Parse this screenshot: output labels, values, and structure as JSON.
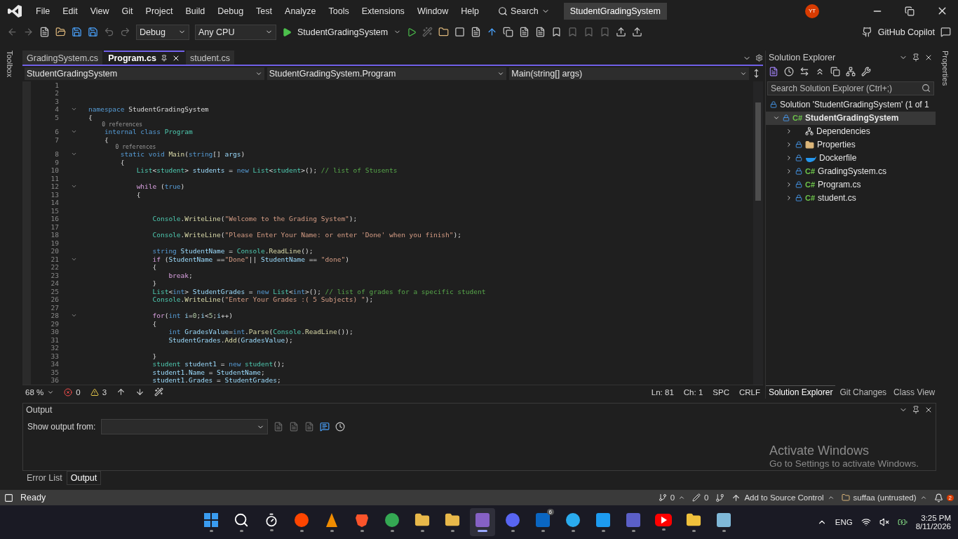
{
  "menu": [
    "File",
    "Edit",
    "View",
    "Git",
    "Project",
    "Build",
    "Debug",
    "Test",
    "Analyze",
    "Tools",
    "Extensions",
    "Window",
    "Help"
  ],
  "search": "Search",
  "solution_title": "StudentGradingSystem",
  "avatar": "YT",
  "toolbar": {
    "configuration": "Debug",
    "platform": "Any CPU",
    "startup": "StudentGradingSystem",
    "copilot": "GitHub Copilot"
  },
  "toolbox": "Toolbox",
  "properties_tab": "Properties",
  "tabs": [
    {
      "label": "GradingSystem.cs",
      "selected": false
    },
    {
      "label": "Program.cs",
      "selected": true
    },
    {
      "label": "student.cs",
      "selected": false
    }
  ],
  "nav": [
    "StudentGradingSystem",
    "StudentGradingSystem.Program",
    "Main(string[] args)"
  ],
  "code": [
    {
      "kind": "line",
      "n": "1",
      "fold": false
    },
    {
      "kind": "line",
      "n": "2",
      "fold": false
    },
    {
      "kind": "line",
      "n": "3",
      "fold": false
    },
    {
      "kind": "line",
      "n": "4",
      "fold": true,
      "tokens": [
        {
          "text": "namespace",
          "kind": "kw"
        },
        {
          "text": " StudentGradingSystem",
          "kind": "txt"
        }
      ]
    },
    {
      "kind": "line",
      "n": "5",
      "fold": false,
      "tokens": [
        {
          "text": "{",
          "kind": "txt"
        }
      ]
    },
    {
      "kind": "lens",
      "text": "    0 references"
    },
    {
      "kind": "line",
      "n": "6",
      "fold": true,
      "tokens": [
        {
          "text": "    internal class",
          "kind": "kw"
        },
        {
          "text": " Program",
          "kind": "type"
        }
      ]
    },
    {
      "kind": "line",
      "n": "7",
      "fold": false,
      "tokens": [
        {
          "text": "    {",
          "kind": "txt"
        }
      ]
    },
    {
      "kind": "lens",
      "text": "        0 references"
    },
    {
      "kind": "line",
      "n": "8",
      "fold": true,
      "tokens": [
        {
          "text": "        static void",
          "kind": "kw"
        },
        {
          "text": " Main",
          "kind": "fn"
        },
        {
          "text": "(",
          "kind": "txt"
        },
        {
          "text": "string",
          "kind": "kw"
        },
        {
          "text": "[] ",
          "kind": "txt"
        },
        {
          "text": "args",
          "kind": "var"
        },
        {
          "text": ")",
          "kind": "txt"
        }
      ]
    },
    {
      "kind": "line",
      "n": "9",
      "fold": false,
      "tokens": [
        {
          "text": "        {",
          "kind": "txt"
        }
      ]
    },
    {
      "kind": "line",
      "n": "10",
      "fold": false,
      "tokens": [
        {
          "text": "            List",
          "kind": "type"
        },
        {
          "text": "<",
          "kind": "txt"
        },
        {
          "text": "student",
          "kind": "type"
        },
        {
          "text": "> ",
          "kind": "txt"
        },
        {
          "text": "students",
          "kind": "var"
        },
        {
          "text": " = ",
          "kind": "txt"
        },
        {
          "text": "new",
          "kind": "kw"
        },
        {
          "text": " List",
          "kind": "type"
        },
        {
          "text": "<",
          "kind": "txt"
        },
        {
          "text": "student",
          "kind": "type"
        },
        {
          "text": ">(); ",
          "kind": "txt"
        },
        {
          "text": "// list of Stusents",
          "kind": "cmt"
        }
      ]
    },
    {
      "kind": "line",
      "n": "11",
      "fold": false
    },
    {
      "kind": "line",
      "n": "12",
      "fold": true,
      "tokens": [
        {
          "text": "            while",
          "kind": "ctl"
        },
        {
          "text": " (",
          "kind": "txt"
        },
        {
          "text": "true",
          "kind": "kw"
        },
        {
          "text": ")",
          "kind": "txt"
        }
      ]
    },
    {
      "kind": "line",
      "n": "13",
      "fold": false,
      "tokens": [
        {
          "text": "            {",
          "kind": "txt"
        }
      ]
    },
    {
      "kind": "line",
      "n": "14",
      "fold": false
    },
    {
      "kind": "line",
      "n": "15",
      "fold": false
    },
    {
      "kind": "line",
      "n": "16",
      "fold": false,
      "tokens": [
        {
          "text": "                Console",
          "kind": "type"
        },
        {
          "text": ".",
          "kind": "txt"
        },
        {
          "text": "WriteLine",
          "kind": "fn"
        },
        {
          "text": "(",
          "kind": "txt"
        },
        {
          "text": "\"Welcome to the Grading System\"",
          "kind": "str"
        },
        {
          "text": ");",
          "kind": "txt"
        }
      ]
    },
    {
      "kind": "line",
      "n": "17",
      "fold": false
    },
    {
      "kind": "line",
      "n": "18",
      "fold": false,
      "tokens": [
        {
          "text": "                Console",
          "kind": "type"
        },
        {
          "text": ".",
          "kind": "txt"
        },
        {
          "text": "WriteLine",
          "kind": "fn"
        },
        {
          "text": "(",
          "kind": "txt"
        },
        {
          "text": "\"Please Enter Your Name: or enter 'Done' when you finish\"",
          "kind": "str"
        },
        {
          "text": ");",
          "kind": "txt"
        }
      ]
    },
    {
      "kind": "line",
      "n": "19",
      "fold": false
    },
    {
      "kind": "line",
      "n": "20",
      "fold": false,
      "tokens": [
        {
          "text": "                string",
          "kind": "kw"
        },
        {
          "text": " StudentName",
          "kind": "var"
        },
        {
          "text": " = ",
          "kind": "txt"
        },
        {
          "text": "Console",
          "kind": "type"
        },
        {
          "text": ".",
          "kind": "txt"
        },
        {
          "text": "ReadLine",
          "kind": "fn"
        },
        {
          "text": "();",
          "kind": "txt"
        }
      ]
    },
    {
      "kind": "line",
      "n": "21",
      "fold": true,
      "tokens": [
        {
          "text": "                if",
          "kind": "ctl"
        },
        {
          "text": " (",
          "kind": "txt"
        },
        {
          "text": "StudentName",
          "kind": "var"
        },
        {
          "text": " ==",
          "kind": "txt"
        },
        {
          "text": "\"Done\"",
          "kind": "str"
        },
        {
          "text": "|| ",
          "kind": "txt"
        },
        {
          "text": "StudentName",
          "kind": "var"
        },
        {
          "text": " == ",
          "kind": "txt"
        },
        {
          "text": "\"done\"",
          "kind": "str"
        },
        {
          "text": ")",
          "kind": "txt"
        }
      ]
    },
    {
      "kind": "line",
      "n": "22",
      "fold": false,
      "tokens": [
        {
          "text": "                {",
          "kind": "txt"
        }
      ]
    },
    {
      "kind": "line",
      "n": "23",
      "fold": false,
      "tokens": [
        {
          "text": "                    break",
          "kind": "ctl"
        },
        {
          "text": ";",
          "kind": "txt"
        }
      ]
    },
    {
      "kind": "line",
      "n": "24",
      "fold": false,
      "tokens": [
        {
          "text": "                }",
          "kind": "txt"
        }
      ]
    },
    {
      "kind": "line",
      "n": "25",
      "fold": false,
      "tokens": [
        {
          "text": "                List",
          "kind": "type"
        },
        {
          "text": "<",
          "kind": "txt"
        },
        {
          "text": "int",
          "kind": "kw"
        },
        {
          "text": "> ",
          "kind": "txt"
        },
        {
          "text": "StudentGrades",
          "kind": "var"
        },
        {
          "text": " = ",
          "kind": "txt"
        },
        {
          "text": "new",
          "kind": "kw"
        },
        {
          "text": " List",
          "kind": "type"
        },
        {
          "text": "<",
          "kind": "txt"
        },
        {
          "text": "int",
          "kind": "kw"
        },
        {
          "text": ">(); ",
          "kind": "txt"
        },
        {
          "text": "// list of grades for a specific student",
          "kind": "cmt"
        }
      ]
    },
    {
      "kind": "line",
      "n": "26",
      "fold": false,
      "tokens": [
        {
          "text": "                Console",
          "kind": "type"
        },
        {
          "text": ".",
          "kind": "txt"
        },
        {
          "text": "WriteLine",
          "kind": "fn"
        },
        {
          "text": "(",
          "kind": "txt"
        },
        {
          "text": "\"Enter Your Grades :( 5 Subjects) \"",
          "kind": "str"
        },
        {
          "text": ");",
          "kind": "txt"
        }
      ]
    },
    {
      "kind": "line",
      "n": "27",
      "fold": false
    },
    {
      "kind": "line",
      "n": "28",
      "fold": true,
      "tokens": [
        {
          "text": "                for",
          "kind": "ctl"
        },
        {
          "text": "(",
          "kind": "txt"
        },
        {
          "text": "int",
          "kind": "kw"
        },
        {
          "text": " i",
          "kind": "var"
        },
        {
          "text": "=",
          "kind": "txt"
        },
        {
          "text": "0",
          "kind": "num"
        },
        {
          "text": ";",
          "kind": "txt"
        },
        {
          "text": "i",
          "kind": "var"
        },
        {
          "text": "<",
          "kind": "txt"
        },
        {
          "text": "5",
          "kind": "num"
        },
        {
          "text": ";",
          "kind": "txt"
        },
        {
          "text": "i",
          "kind": "var"
        },
        {
          "text": "++)",
          "kind": "txt"
        }
      ]
    },
    {
      "kind": "line",
      "n": "29",
      "fold": false,
      "tokens": [
        {
          "text": "                {",
          "kind": "txt"
        }
      ]
    },
    {
      "kind": "line",
      "n": "30",
      "fold": false,
      "tokens": [
        {
          "text": "                    int",
          "kind": "kw"
        },
        {
          "text": " GradesValue",
          "kind": "var"
        },
        {
          "text": "=",
          "kind": "txt"
        },
        {
          "text": "int",
          "kind": "kw"
        },
        {
          "text": ".",
          "kind": "txt"
        },
        {
          "text": "Parse",
          "kind": "fn"
        },
        {
          "text": "(",
          "kind": "txt"
        },
        {
          "text": "Console",
          "kind": "type"
        },
        {
          "text": ".",
          "kind": "txt"
        },
        {
          "text": "ReadLine",
          "kind": "fn"
        },
        {
          "text": "());",
          "kind": "txt"
        }
      ]
    },
    {
      "kind": "line",
      "n": "31",
      "fold": false,
      "tokens": [
        {
          "text": "                    StudentGrades",
          "kind": "var"
        },
        {
          "text": ".",
          "kind": "txt"
        },
        {
          "text": "Add",
          "kind": "fn"
        },
        {
          "text": "(",
          "kind": "txt"
        },
        {
          "text": "GradesValue",
          "kind": "var"
        },
        {
          "text": ");",
          "kind": "txt"
        }
      ]
    },
    {
      "kind": "line",
      "n": "32",
      "fold": false
    },
    {
      "kind": "line",
      "n": "33",
      "fold": false,
      "tokens": [
        {
          "text": "                }",
          "kind": "txt"
        }
      ]
    },
    {
      "kind": "line",
      "n": "34",
      "fold": false,
      "tokens": [
        {
          "text": "                student",
          "kind": "type"
        },
        {
          "text": " student1",
          "kind": "var"
        },
        {
          "text": " = ",
          "kind": "txt"
        },
        {
          "text": "new",
          "kind": "kw"
        },
        {
          "text": " student",
          "kind": "type"
        },
        {
          "text": "();",
          "kind": "txt"
        }
      ]
    },
    {
      "kind": "line",
      "n": "35",
      "fold": false,
      "tokens": [
        {
          "text": "                student1",
          "kind": "var"
        },
        {
          "text": ".",
          "kind": "txt"
        },
        {
          "text": "Name",
          "kind": "var"
        },
        {
          "text": " = ",
          "kind": "txt"
        },
        {
          "text": "StudentName",
          "kind": "var"
        },
        {
          "text": ";",
          "kind": "txt"
        }
      ]
    },
    {
      "kind": "line",
      "n": "36",
      "fold": false,
      "tokens": [
        {
          "text": "                student1",
          "kind": "var"
        },
        {
          "text": ".",
          "kind": "txt"
        },
        {
          "text": "Grades",
          "kind": "var"
        },
        {
          "text": " = ",
          "kind": "txt"
        },
        {
          "text": "StudentGrades",
          "kind": "var"
        },
        {
          "text": ";",
          "kind": "txt"
        }
      ]
    }
  ],
  "editor_status": {
    "zoom": "68 %",
    "errors": "0",
    "warnings": "3",
    "line": "Ln: 81",
    "col": "Ch: 1",
    "spaces": "SPC",
    "eol": "CRLF"
  },
  "solution_explorer": {
    "title": "Solution Explorer",
    "search_placeholder": "Search Solution Explorer (Ctrl+;)",
    "solution": "Solution 'StudentGradingSystem' (1 of 1",
    "project": "StudentGradingSystem",
    "project_badge": "C#",
    "project_expanded": true,
    "items": [
      {
        "label": "Dependencies",
        "kind": "dependencies"
      },
      {
        "label": "Properties",
        "kind": "folder"
      },
      {
        "label": "Dockerfile",
        "kind": "docker"
      },
      {
        "label": "GradingSystem.cs",
        "kind": "csharp",
        "badge": "C#"
      },
      {
        "label": "Program.cs",
        "kind": "csharp",
        "badge": "C#"
      },
      {
        "label": "student.cs",
        "kind": "csharp",
        "badge": "C#"
      }
    ],
    "tabs": [
      {
        "label": "Solution Explorer",
        "selected": true
      },
      {
        "label": "Git Changes",
        "selected": false
      },
      {
        "label": "Class View",
        "selected": false
      }
    ]
  },
  "output": {
    "title": "Output",
    "show_from": "Show output from:"
  },
  "bottom_tabs": [
    {
      "label": "Error List",
      "selected": false
    },
    {
      "label": "Output",
      "selected": true
    }
  ],
  "activation": {
    "title": "Activate Windows",
    "subtitle": "Go to Settings to activate Windows."
  },
  "status_bar": {
    "ready": "Ready",
    "commits": "0",
    "changes": "0",
    "source": "Add to Source Control",
    "repo": "suffaa (untrusted)",
    "notifications": "2"
  },
  "taskbar": {
    "apps": [
      {
        "kind": "start",
        "color": "#3a9cf0",
        "selected": false
      },
      {
        "kind": "search",
        "color": "#ffffff",
        "selected": false
      },
      {
        "kind": "timer",
        "color": "#ffffff",
        "selected": false
      },
      {
        "kind": "circle",
        "color": "#ff4500",
        "selected": false
      },
      {
        "kind": "cone",
        "color": "#f08c00",
        "selected": false
      },
      {
        "kind": "shield",
        "color": "#fb542b",
        "selected": false
      },
      {
        "kind": "circle",
        "color": "#34a853",
        "selected": false
      },
      {
        "kind": "folder",
        "color": "#e8b84a",
        "selected": false
      },
      {
        "kind": "folder",
        "color": "#e8b84a",
        "selected": false
      },
      {
        "kind": "square",
        "color": "#8661c5",
        "selected": true
      },
      {
        "kind": "circle",
        "color": "#5865f2",
        "selected": false
      },
      {
        "kind": "square",
        "color": "#0a66c2",
        "selected": false,
        "badge": "6"
      },
      {
        "kind": "circle",
        "color": "#2aabee",
        "selected": false
      },
      {
        "kind": "square",
        "color": "#1d9bf0",
        "selected": false
      },
      {
        "kind": "square",
        "color": "#5b5fc7",
        "selected": false
      },
      {
        "kind": "play",
        "color": "#ff0000",
        "selected": false
      },
      {
        "kind": "folder",
        "color": "#f0c13c",
        "selected": false
      },
      {
        "kind": "square",
        "color": "#7fb8d8",
        "selected": false
      }
    ],
    "lang": "ENG",
    "time": "3:25 PM",
    "date": "8/11/2026"
  }
}
